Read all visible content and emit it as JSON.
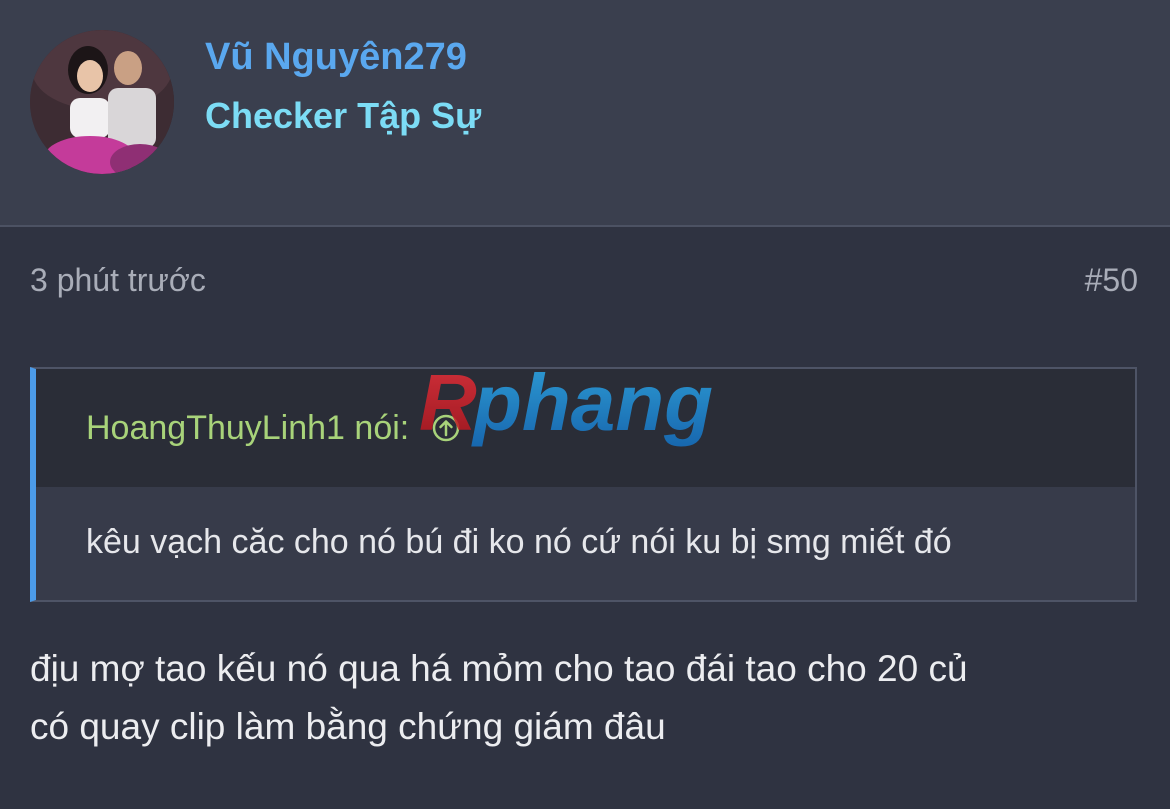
{
  "user": {
    "name": "Vũ Nguyên279",
    "title": "Checker Tập Sự"
  },
  "post": {
    "time": "3 phút trước",
    "number": "#50",
    "body_line1": "địu mợ tao kếu nó qua há mỏm cho tao đái tao cho 20 củ",
    "body_line2": "có quay clip làm bằng chứng giám đâu"
  },
  "quote": {
    "author": "HoangThuyLinh1",
    "says": "nói:",
    "text": "kêu vạch căc cho nó bú đi ko nó cứ nói ku bị smg miết đó"
  },
  "watermark": {
    "text": "Rphang"
  },
  "icons": {
    "quote_jump": "arrow-up-circle-icon"
  },
  "colors": {
    "username": "#5aa8ef",
    "usertitle": "#7cdcf5",
    "quote_author": "#a8d37a",
    "quote_bar": "#4c9be8"
  }
}
